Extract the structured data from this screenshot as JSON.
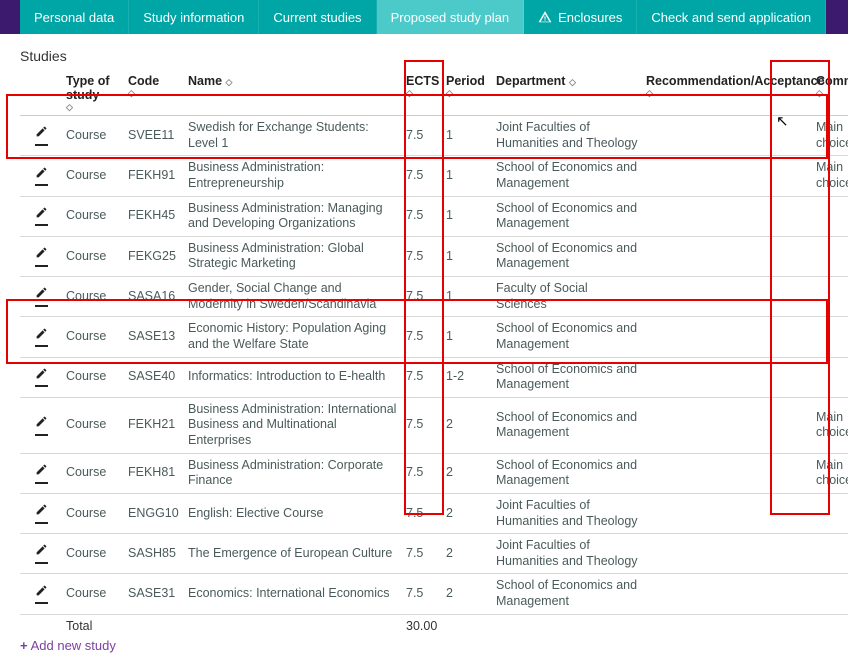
{
  "tabs": {
    "personal": "Personal data",
    "studyinfo": "Study information",
    "current": "Current studies",
    "proposed": "Proposed study plan",
    "enclosures": "Enclosures",
    "check": "Check and send application"
  },
  "section_title": "Studies",
  "headers": {
    "type": "Type of study",
    "code": "Code",
    "name": "Name",
    "ects": "ECTS",
    "period": "Period",
    "department": "Department",
    "rec": "Recommendation/Acceptance",
    "comment": "Comment"
  },
  "rows": [
    {
      "type": "Course",
      "code": "SVEE11",
      "name": "Swedish for Exchange Students: Level 1",
      "ects": "7.5",
      "period": "1",
      "dept": "Joint Faculties of Humanities and Theology",
      "rec": "",
      "comment": "Main choice"
    },
    {
      "type": "Course",
      "code": "FEKH91",
      "name": "Business Administration: Entrepreneurship",
      "ects": "7.5",
      "period": "1",
      "dept": "School of Economics and Management",
      "rec": "",
      "comment": "Main choice"
    },
    {
      "type": "Course",
      "code": "FEKH45",
      "name": "Business Administration: Managing and Developing Organizations",
      "ects": "7.5",
      "period": "1",
      "dept": "School of Economics and Management",
      "rec": "",
      "comment": ""
    },
    {
      "type": "Course",
      "code": "FEKG25",
      "name": "Business Administration: Global Strategic Marketing",
      "ects": "7.5",
      "period": "1",
      "dept": "School of Economics and Management",
      "rec": "",
      "comment": ""
    },
    {
      "type": "Course",
      "code": "SASA16",
      "name": "Gender, Social Change and Modernity in Sweden/Scandinavia",
      "ects": "7.5",
      "period": "1",
      "dept": "Faculty of Social Sciences",
      "rec": "",
      "comment": ""
    },
    {
      "type": "Course",
      "code": "SASE13",
      "name": "Economic History: Population Aging and the Welfare State",
      "ects": "7.5",
      "period": "1",
      "dept": "School of Economics and Management",
      "rec": "",
      "comment": ""
    },
    {
      "type": "Course",
      "code": "SASE40",
      "name": "Informatics: Introduction to E-health",
      "ects": "7.5",
      "period": "1-2",
      "dept": "School of Economics and Management",
      "rec": "",
      "comment": ""
    },
    {
      "type": "Course",
      "code": "FEKH21",
      "name": "Business Administration: International Business and Multinational Enterprises",
      "ects": "7.5",
      "period": "2",
      "dept": "School of Economics and Management",
      "rec": "",
      "comment": "Main choice"
    },
    {
      "type": "Course",
      "code": "FEKH81",
      "name": "Business Administration: Corporate Finance",
      "ects": "7.5",
      "period": "2",
      "dept": "School of Economics and Management",
      "rec": "",
      "comment": "Main choice"
    },
    {
      "type": "Course",
      "code": "ENGG10",
      "name": "English: Elective Course",
      "ects": "7.5",
      "period": "2",
      "dept": "Joint Faculties of Humanities and Theology",
      "rec": "",
      "comment": ""
    },
    {
      "type": "Course",
      "code": "SASH85",
      "name": "The Emergence of European Culture",
      "ects": "7.5",
      "period": "2",
      "dept": "Joint Faculties of Humanities and Theology",
      "rec": "",
      "comment": ""
    },
    {
      "type": "Course",
      "code": "SASE31",
      "name": "Economics: International Economics",
      "ects": "7.5",
      "period": "2",
      "dept": "School of Economics and Management",
      "rec": "",
      "comment": ""
    }
  ],
  "total_label": "Total",
  "total_value": "30.00",
  "add_label": "Add new study"
}
